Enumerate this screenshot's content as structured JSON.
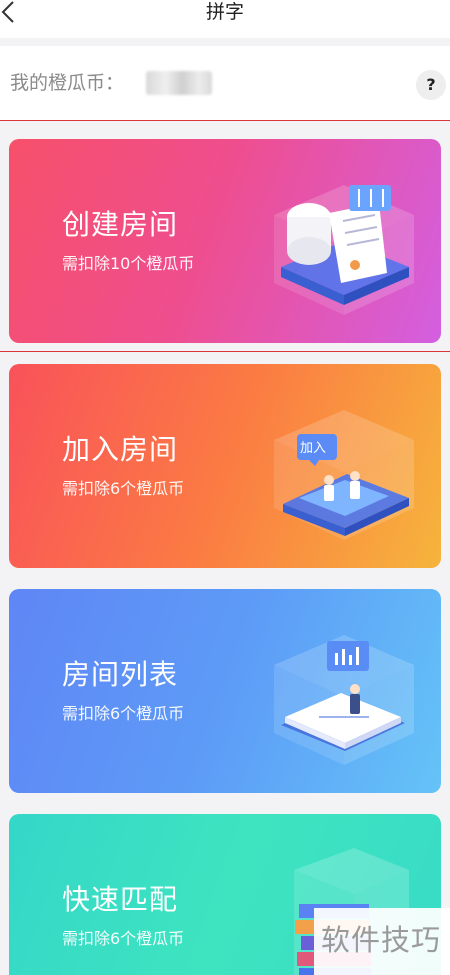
{
  "header": {
    "title": "拼字"
  },
  "coins": {
    "label": "我的橙瓜币：",
    "help": "?"
  },
  "cards": [
    {
      "title": "创建房间",
      "subtitle": "需扣除10个橙瓜币"
    },
    {
      "title": "加入房间",
      "subtitle": "需扣除6个橙瓜币",
      "badge": "加入"
    },
    {
      "title": "房间列表",
      "subtitle": "需扣除6个橙瓜币"
    },
    {
      "title": "快速匹配",
      "subtitle": "需扣除6个橙瓜币"
    }
  ],
  "watermark": "软件技巧"
}
